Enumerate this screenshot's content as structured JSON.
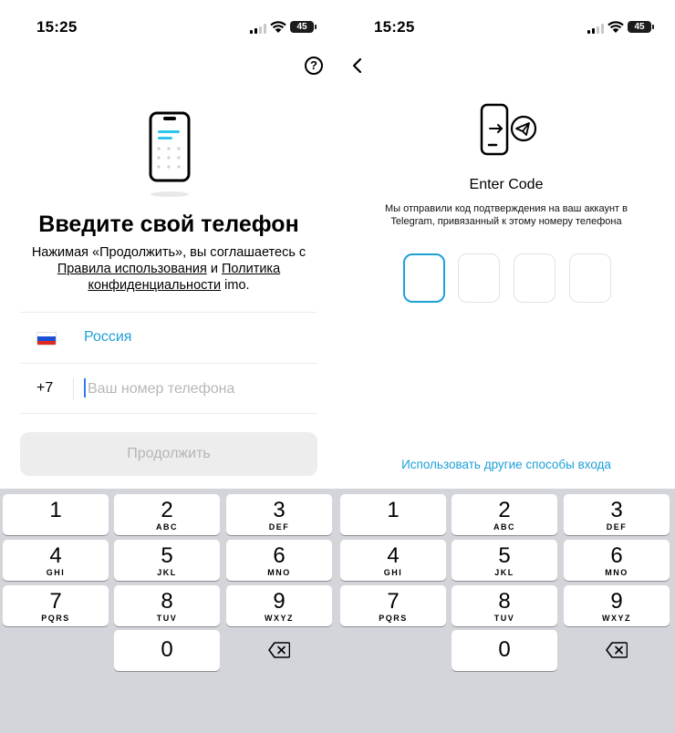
{
  "left_screen": {
    "status": {
      "time": "15:25",
      "battery": "45"
    },
    "help_icon": "?",
    "illustration": "phone-icon",
    "title": "Введите свой телефон",
    "legal": {
      "prefix": "Нажимая «Продолжить», вы соглашаетесь с ",
      "terms_link": "Правила использования",
      "and": " и ",
      "privacy_link": "Политика конфиденциальности",
      "suffix": " imo."
    },
    "country": {
      "flag": "russia-flag-icon",
      "name": "Россия"
    },
    "phone": {
      "code": "+7",
      "value": "",
      "placeholder": "Ваш номер телефона"
    },
    "continue_label": "Продолжить",
    "colors": {
      "accent": "#1ea0d8",
      "button_disabled_bg": "#ededed",
      "button_disabled_text": "#b5b5b5"
    }
  },
  "right_screen": {
    "status": {
      "time": "15:25",
      "battery": "45"
    },
    "back_icon": "chevron-left-icon",
    "illustration": "phone-telegram-icon",
    "title": "Enter Code",
    "subtitle_line1": "Мы отправили код подтверждения на ваш аккаунт в",
    "subtitle_line2": "Telegram, привязанный к этому номеру телефона",
    "code_length": 4,
    "alt_login": "Использовать другие способы входа"
  },
  "keyboard": {
    "keys": [
      {
        "num": "1",
        "letters": ""
      },
      {
        "num": "2",
        "letters": "ABC"
      },
      {
        "num": "3",
        "letters": "DEF"
      },
      {
        "num": "4",
        "letters": "GHI"
      },
      {
        "num": "5",
        "letters": "JKL"
      },
      {
        "num": "6",
        "letters": "MNO"
      },
      {
        "num": "7",
        "letters": "PQRS"
      },
      {
        "num": "8",
        "letters": "TUV"
      },
      {
        "num": "9",
        "letters": "WXYZ"
      },
      {
        "num": "0",
        "letters": ""
      }
    ],
    "delete_icon": "backspace-icon",
    "background": "#d3d5da"
  }
}
